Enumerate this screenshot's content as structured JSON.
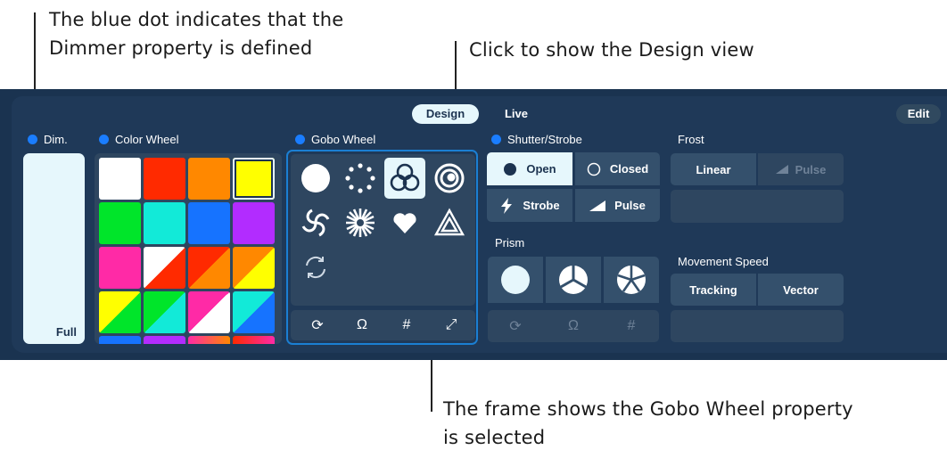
{
  "annotations": {
    "blue_dot": [
      "The blue dot indicates that the",
      "Dimmer property is defined"
    ],
    "design_view": "Click to show the Design view",
    "gobo_frame": [
      "The frame shows the Gobo Wheel property",
      "is selected"
    ]
  },
  "toolbar": {
    "design_label": "Design",
    "live_label": "Live",
    "edit_label": "Edit"
  },
  "dimmer": {
    "label": "Dim.",
    "value_label": "Full"
  },
  "color_wheel": {
    "label": "Color Wheel"
  },
  "gobo_wheel": {
    "label": "Gobo Wheel",
    "tools": [
      "⟳",
      "Ω",
      "#",
      "⤢"
    ]
  },
  "shutter": {
    "label": "Shutter/Strobe",
    "open": "Open",
    "closed": "Closed",
    "strobe": "Strobe",
    "pulse": "Pulse"
  },
  "prism": {
    "label": "Prism",
    "tools": [
      "⟳",
      "Ω",
      "#"
    ]
  },
  "frost": {
    "label": "Frost",
    "linear": "Linear",
    "pulse": "Pulse"
  },
  "movement_speed": {
    "label": "Movement Speed",
    "tracking": "Tracking",
    "vector": "Vector"
  },
  "colors": {
    "accent_dot": "#1a7dff",
    "selection_frame": "#1b7fd3",
    "panel": "#1f3958"
  }
}
